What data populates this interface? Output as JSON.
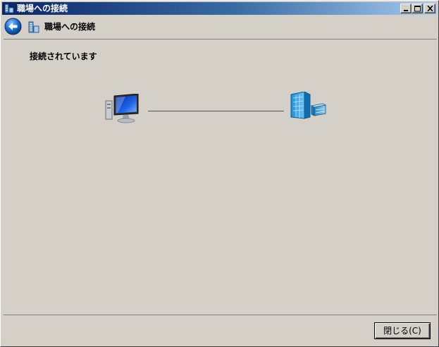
{
  "window": {
    "title": "職場への接続",
    "title_icon": "network-connection-icon",
    "controls": [
      "minimize-icon",
      "maximize-icon",
      "close-icon"
    ]
  },
  "nav": {
    "back_icon": "back-arrow-icon",
    "icon": "network-connection-icon",
    "title": "職場への接続"
  },
  "main": {
    "status": "接続されています",
    "local_icon": "computer-icon",
    "remote_icon": "office-building-icon"
  },
  "footer": {
    "close_label": "閉じる(C)"
  },
  "colors": {
    "titlebar_start": "#0a246a",
    "titlebar_end": "#a6caf0",
    "face": "#d4d0c8",
    "accent_blue": "#1b6fd1"
  }
}
